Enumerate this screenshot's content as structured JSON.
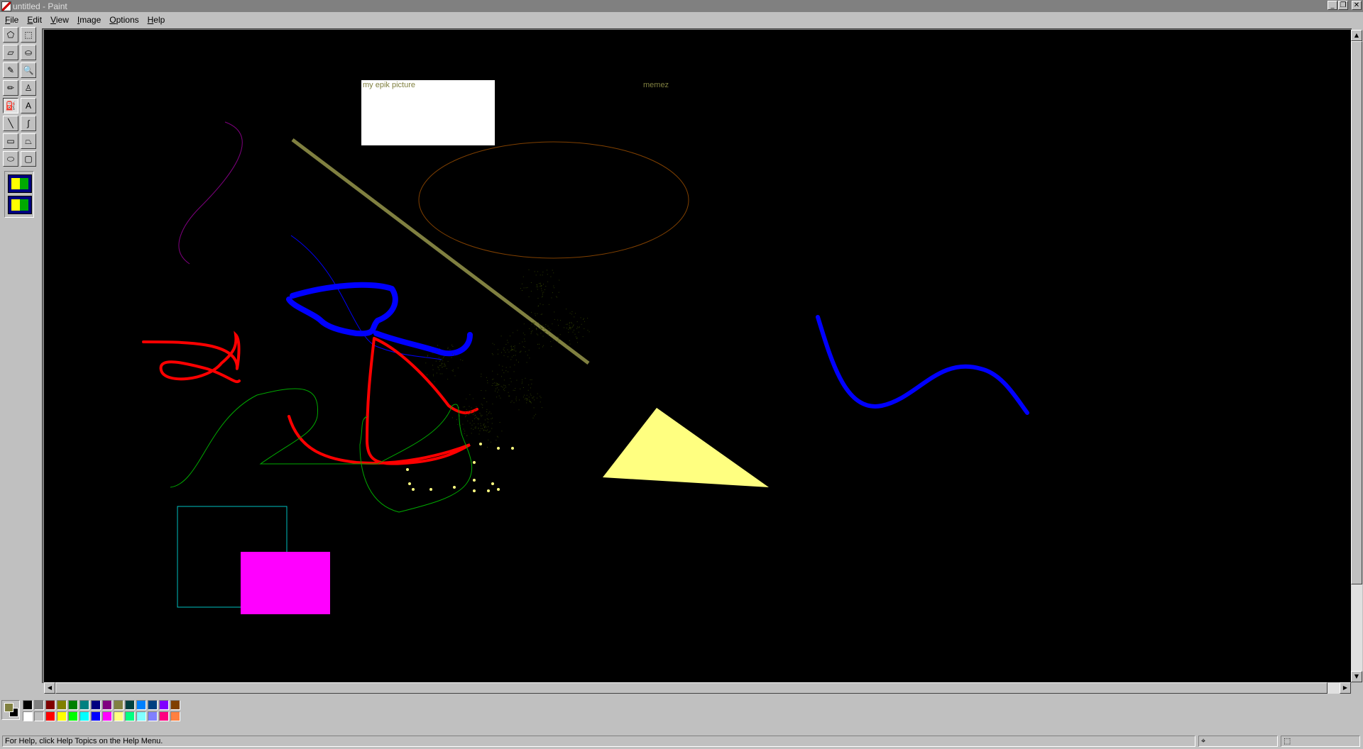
{
  "window": {
    "title": "untitled - Paint",
    "controls": {
      "minimize": "_",
      "restore": "❐",
      "close": "✕"
    }
  },
  "menu": [
    {
      "label": "File"
    },
    {
      "label": "Edit"
    },
    {
      "label": "View"
    },
    {
      "label": "Image"
    },
    {
      "label": "Options"
    },
    {
      "label": "Help"
    }
  ],
  "tools": [
    {
      "name": "free-form-select-icon",
      "glyph": "⬠"
    },
    {
      "name": "select-icon",
      "glyph": "⬚"
    },
    {
      "name": "eraser-icon",
      "glyph": "▱"
    },
    {
      "name": "fill-bucket-icon",
      "glyph": "⛀"
    },
    {
      "name": "pick-color-icon",
      "glyph": "✎"
    },
    {
      "name": "magnifier-icon",
      "glyph": "🔍"
    },
    {
      "name": "pencil-icon",
      "glyph": "✏"
    },
    {
      "name": "brush-icon",
      "glyph": "♙"
    },
    {
      "name": "airbrush-icon",
      "glyph": "⛽"
    },
    {
      "name": "text-icon",
      "glyph": "A"
    },
    {
      "name": "line-icon",
      "glyph": "╲"
    },
    {
      "name": "curve-icon",
      "glyph": "∫"
    },
    {
      "name": "rectangle-icon",
      "glyph": "▭"
    },
    {
      "name": "polygon-icon",
      "glyph": "⏢"
    },
    {
      "name": "ellipse-icon",
      "glyph": "⬭"
    },
    {
      "name": "rounded-rectangle-icon",
      "glyph": "▢"
    }
  ],
  "active_tool": "airbrush-icon",
  "canvas": {
    "background": "#000000",
    "text_box_1": "my epik picture",
    "text_box_2": "memez"
  },
  "colors": {
    "foreground": "#808040",
    "background": "#000000",
    "palette_top": [
      "#000000",
      "#808080",
      "#800000",
      "#808000",
      "#008000",
      "#008080",
      "#000080",
      "#800080",
      "#808040",
      "#004040",
      "#0080ff",
      "#004080",
      "#8000ff",
      "#804000"
    ],
    "palette_bottom": [
      "#ffffff",
      "#c0c0c0",
      "#ff0000",
      "#ffff00",
      "#00ff00",
      "#00ffff",
      "#0000ff",
      "#ff00ff",
      "#ffff80",
      "#00ff80",
      "#80ffff",
      "#8080ff",
      "#ff0080",
      "#ff8040"
    ]
  },
  "status": {
    "help_text": "For Help, click Help Topics on the Help Menu.",
    "position": "",
    "size": ""
  }
}
